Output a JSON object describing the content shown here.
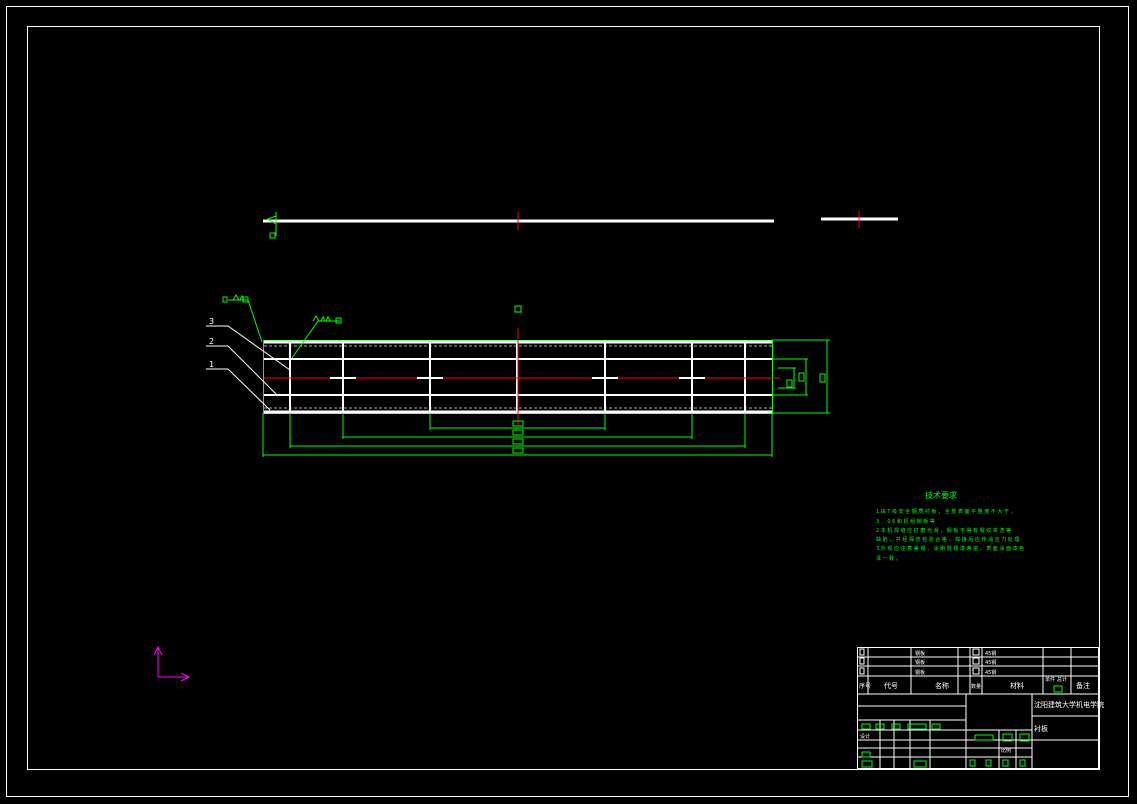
{
  "colors": {
    "background": "#000000",
    "border": "#ffffff",
    "geometry": "#ffffff",
    "dimension": "#00ff00",
    "centerline": "#ff0000",
    "ucs": "#ff00ff",
    "notes": "#00ff00"
  },
  "leaders": {
    "part3": "3",
    "part2": "2",
    "part1": "1"
  },
  "notes": {
    "title": "技术要求",
    "lines": [
      "1.由 T 级 安 全 钢 质 衬 板 ， 全 部 表 面 平 整 度 不 大 于 ，",
      "  3 ． 0 6 和 机 组 钢 板 等",
      "2.本 机 焊 缝 应 打 磨 光 滑 ， 钢 板 不 得 有 裂 纹 夹 渣 等",
      "  缺 陷 ， 并 经 探 伤 检 验 合 格 ， 焊 接 后 应 作 消 应 力 处 理",
      "3.外 观 应 注 意 美 观 ， 涂 刷 防 锈 漆 两 遍 ， 表 面 涂 面 漆 色",
      "  泽 一 致 。"
    ]
  },
  "title_block": {
    "header": {
      "seq": "序号",
      "code": "代号",
      "name": "名称",
      "qty": "数量",
      "material": "材料",
      "single": "单件",
      "total": "总计",
      "remark": "备注"
    },
    "rows": [
      {
        "seq": "3",
        "name": "钢板",
        "material": "45钢"
      },
      {
        "seq": "2",
        "name": "钢板",
        "material": "45钢"
      },
      {
        "seq": "1",
        "name": "钢板",
        "material": "45钢"
      }
    ],
    "school": "沈阳建筑大学机电学院",
    "drawing_name": "衬板",
    "designer": "设计",
    "scale_label": "比例"
  }
}
